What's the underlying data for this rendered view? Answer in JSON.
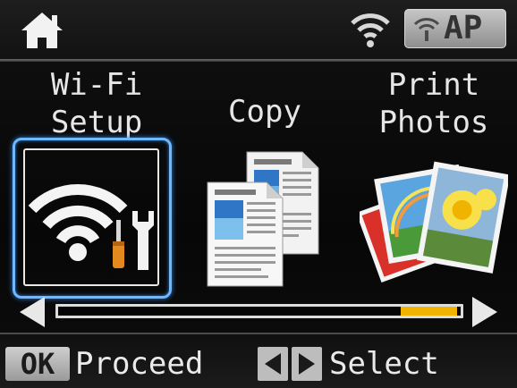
{
  "status_bar": {
    "home_icon": "home-icon",
    "wifi_icon": "wifi-signal-icon",
    "ap_badge": {
      "icon": "wifi-ap-icon",
      "text": "AP"
    }
  },
  "menu": {
    "selected_index": 0,
    "items": [
      {
        "label": "Wi-Fi\nSetup",
        "icon": "wifi-settings-icon",
        "selected": true
      },
      {
        "label": "Copy",
        "icon": "copy-documents-icon",
        "selected": false
      },
      {
        "label": "Print\nPhotos",
        "icon": "print-photos-icon",
        "selected": false
      }
    ]
  },
  "scroll": {
    "left_icon": "arrow-left-icon",
    "right_icon": "arrow-right-icon",
    "thumb_start_fraction": 0.85,
    "thumb_end_fraction": 0.99
  },
  "footer": {
    "ok_key": "OK",
    "ok_action": "Proceed",
    "select_icon": "left-right-arrows-icon",
    "select_action": "Select"
  },
  "colors": {
    "selection": "#6fb7ff",
    "scroll_thumb": "#f0b400",
    "text": "#e6e6e6"
  }
}
